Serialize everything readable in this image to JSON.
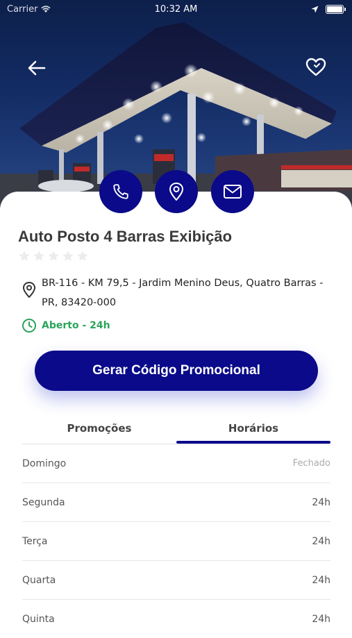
{
  "status_bar": {
    "carrier": "Carrier",
    "time": "10:32 AM"
  },
  "header": {
    "back_icon": "arrow-left-icon",
    "favorite_icon": "heart-icon"
  },
  "actions": [
    {
      "name": "call",
      "icon": "phone-icon"
    },
    {
      "name": "location",
      "icon": "map-pin-icon"
    },
    {
      "name": "email",
      "icon": "mail-icon"
    }
  ],
  "station": {
    "name": "Auto Posto 4 Barras Exibição",
    "rating": 0,
    "address_line1": "BR-116 - KM 79,5 - Jardim Menino Deus, Quatro Barras -",
    "address_line2": "PR, 83420-000",
    "open_status": "Aberto - 24h"
  },
  "cta": {
    "label": "Gerar Código Promocional"
  },
  "tabs": [
    {
      "label": "Promoções",
      "active": false
    },
    {
      "label": "Horários",
      "active": true
    }
  ],
  "schedule": [
    {
      "day": "Domingo",
      "hours": "Fechado",
      "closed": true
    },
    {
      "day": "Segunda",
      "hours": "24h",
      "closed": false
    },
    {
      "day": "Terça",
      "hours": "24h",
      "closed": false
    },
    {
      "day": "Quarta",
      "hours": "24h",
      "closed": false
    },
    {
      "day": "Quinta",
      "hours": "24h",
      "closed": false
    }
  ],
  "colors": {
    "primary": "#0a0a8a",
    "open_green": "#2aa55a",
    "text": "#3a3a3a",
    "divider": "#e6e6e6"
  }
}
